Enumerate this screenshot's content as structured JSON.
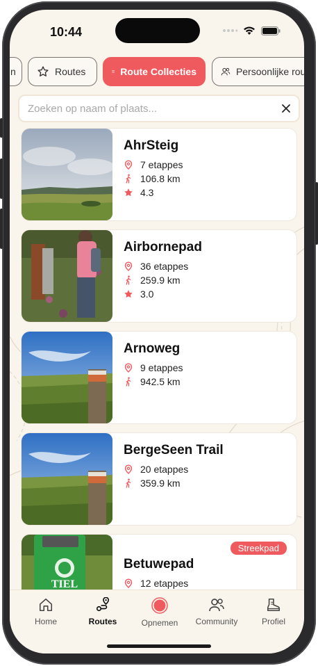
{
  "status": {
    "time": "10:44"
  },
  "tabs": [
    {
      "label": "n"
    },
    {
      "label": "Routes"
    },
    {
      "label": "Route Collecties"
    },
    {
      "label": "Persoonlijke route"
    }
  ],
  "search": {
    "placeholder": "Zoeken op naam of plaats...",
    "value": ""
  },
  "routes": [
    {
      "name": "AhrSteig",
      "stages": "7 etappes",
      "distance": "106.8 km",
      "rating": "4.3"
    },
    {
      "name": "Airbornepad",
      "stages": "36 etappes",
      "distance": "259.9 km",
      "rating": "3.0"
    },
    {
      "name": "Arnoweg",
      "stages": "9 etappes",
      "distance": "942.5 km"
    },
    {
      "name": "BergeSeen Trail",
      "stages": "20 etappes",
      "distance": "359.9 km"
    },
    {
      "name": "Betuwepad",
      "stages": "12 etappes",
      "badge": "Streekpad",
      "thumb_text": "TIEL"
    }
  ],
  "nav": [
    {
      "label": "Home",
      "icon": "home-icon"
    },
    {
      "label": "Routes",
      "icon": "route-pin-icon"
    },
    {
      "label": "Opnemen",
      "icon": "record-icon"
    },
    {
      "label": "Community",
      "icon": "people-icon"
    },
    {
      "label": "Profiel",
      "icon": "boot-icon"
    }
  ],
  "colors": {
    "accent": "#ef5a5f",
    "background": "#f9f4ec"
  }
}
